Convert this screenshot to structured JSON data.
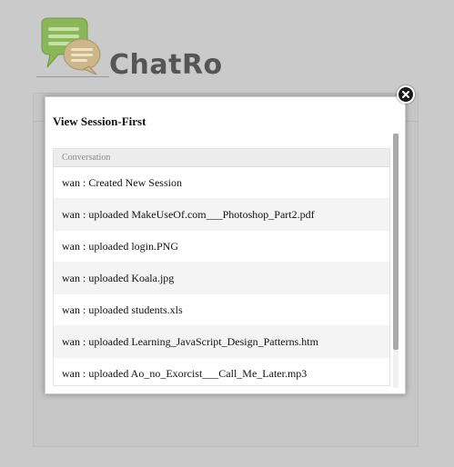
{
  "app": {
    "logo_text": "ChatRo"
  },
  "modal": {
    "title": "View Session-First",
    "column_header": "Conversation",
    "rows": [
      "wan : Created New Session",
      "wan : uploaded MakeUseOf.com___Photoshop_Part2.pdf",
      "wan : uploaded login.PNG",
      "wan : uploaded Koala.jpg",
      "wan : uploaded students.xls",
      "wan : uploaded Learning_JavaScript_Design_Patterns.htm",
      "wan : uploaded Ao_no_Exorcist___Call_Me_Later.mp3"
    ]
  },
  "colors": {
    "backdrop": "#cacaca",
    "logo_green": "#8bb65a",
    "logo_tan": "#cdb68a",
    "logo_text": "#555555"
  },
  "icons": {
    "close": "close-icon",
    "logo": "chat-bubbles-icon"
  }
}
